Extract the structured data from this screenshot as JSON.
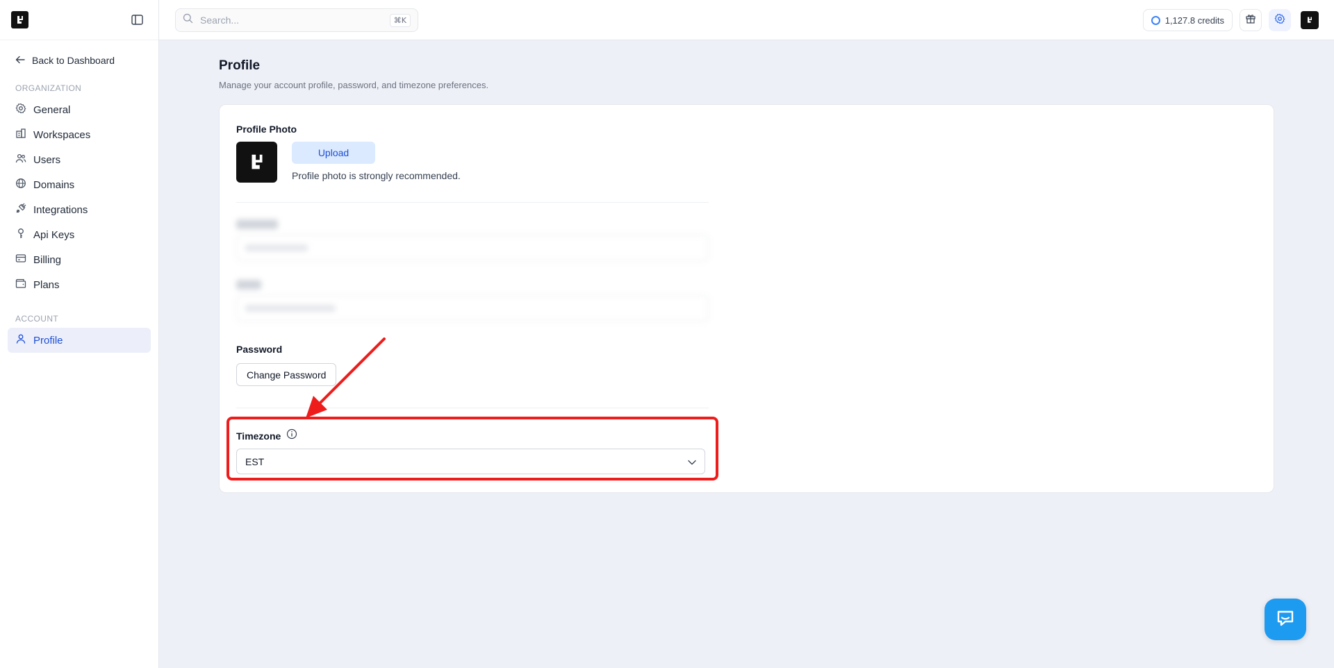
{
  "topbar": {
    "search_placeholder": "Search...",
    "search_shortcut": "⌘K",
    "credits": "1,127.8 credits"
  },
  "sidebar": {
    "back_label": "Back to Dashboard",
    "org_section": "ORGANIZATION",
    "org_items": [
      {
        "label": "General",
        "icon": "gear-icon"
      },
      {
        "label": "Workspaces",
        "icon": "building-icon"
      },
      {
        "label": "Users",
        "icon": "users-icon"
      },
      {
        "label": "Domains",
        "icon": "globe-icon"
      },
      {
        "label": "Integrations",
        "icon": "plug-icon"
      },
      {
        "label": "Api Keys",
        "icon": "key-icon"
      },
      {
        "label": "Billing",
        "icon": "credit-card-icon"
      },
      {
        "label": "Plans",
        "icon": "wallet-icon"
      }
    ],
    "account_section": "ACCOUNT",
    "account_items": [
      {
        "label": "Profile",
        "icon": "user-icon",
        "active": true
      }
    ]
  },
  "main": {
    "title": "Profile",
    "subtitle": "Manage your account profile, password, and timezone preferences.",
    "profile_photo": {
      "label": "Profile Photo",
      "upload_label": "Upload",
      "hint": "Profile photo is strongly recommended."
    },
    "password": {
      "label": "Password",
      "button_label": "Change Password"
    },
    "timezone": {
      "label": "Timezone",
      "value": "EST"
    }
  },
  "colors": {
    "accent": "#1d4ed8",
    "highlight": "#ef1c1c",
    "chat": "#1d9bf0"
  }
}
